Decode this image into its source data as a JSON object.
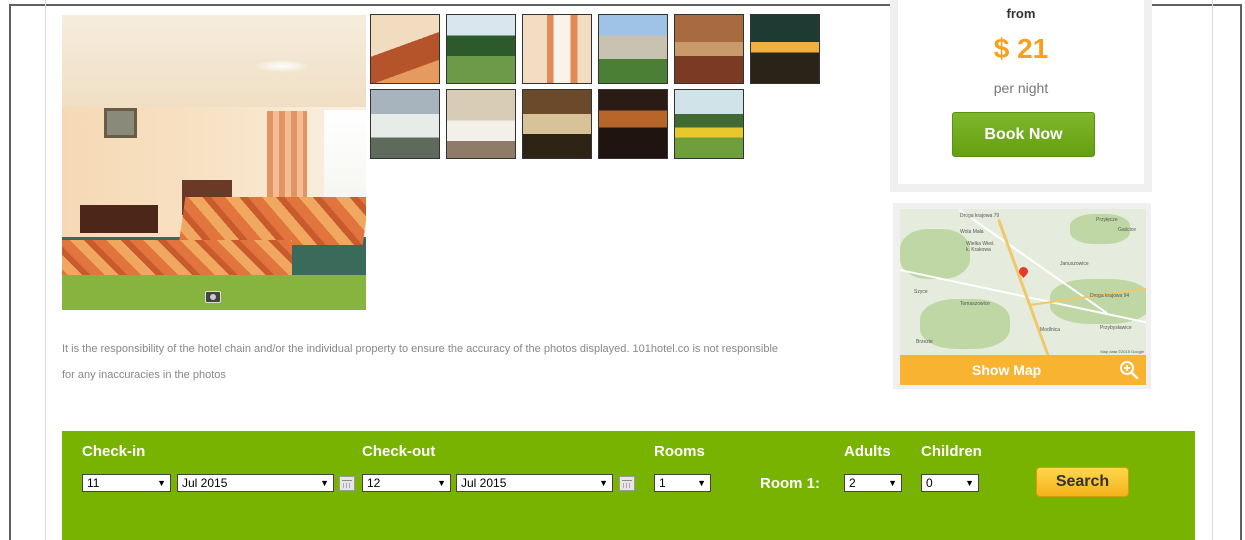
{
  "price": {
    "from_label": "from",
    "amount": "$ 21",
    "per_label": "per night",
    "book_label": "Book Now"
  },
  "map": {
    "show_map_label": "Show Map",
    "credit": "Map data ©2015 Google",
    "labels": [
      "Przyłęcze",
      "Gaścice",
      "Wola Mała",
      "Wielka Wieś",
      "k. Krakowa",
      "Januszowice",
      "Szyce",
      "Modlnica",
      "Tomaszowice",
      "Brzezie",
      "Przybysławice",
      "Droga krajowa 79",
      "Droga krajowa 94"
    ]
  },
  "disclaimer": {
    "line1": "It is the responsibility of the hotel chain and/or the individual property to ensure the accuracy of the photos displayed. 101hotel.co is not responsible",
    "line2": "for any inaccuracies in the photos"
  },
  "search": {
    "checkin_label": "Check-in",
    "checkout_label": "Check-out",
    "rooms_label": "Rooms",
    "adults_label": "Adults",
    "children_label": "Children",
    "room1_label": "Room 1:",
    "checkin_day": "11",
    "checkin_month": "Jul 2015",
    "checkout_day": "12",
    "checkout_month": "Jul 2015",
    "rooms_value": "1",
    "adults_value": "2",
    "children_value": "0",
    "search_label": "Search"
  },
  "thumbnails": [
    "room-twin",
    "garden",
    "room-window",
    "hotel-building",
    "restaurant",
    "night-facade",
    "dining-hall",
    "conference-room",
    "banquet",
    "reception",
    "garden-party"
  ],
  "colors": {
    "accent_green": "#77b300",
    "price_orange": "#f7a01e",
    "map_button": "#f8b431",
    "search_button": "#f5b21a"
  }
}
